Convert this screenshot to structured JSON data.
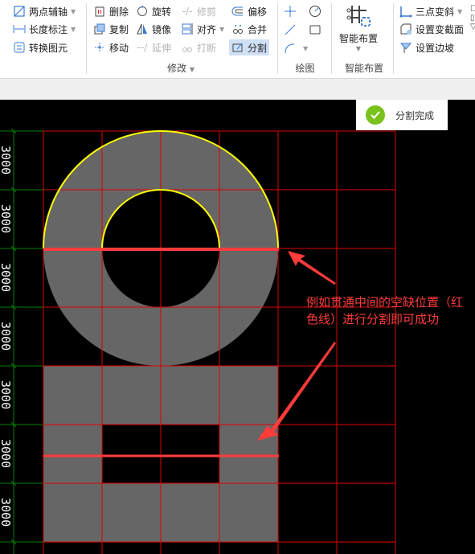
{
  "ribbon": {
    "col1": [
      {
        "label": "两点辅轴",
        "icon": "two-point-axis-icon",
        "dropdown": true
      },
      {
        "label": "长度标注",
        "icon": "length-dimension-icon",
        "dropdown": true
      },
      {
        "label": "转换图元",
        "icon": "convert-element-icon",
        "dropdown": false
      }
    ],
    "modify": {
      "group_label": "修改",
      "buttons": [
        {
          "label": "删除",
          "icon": "delete-icon",
          "enabled": true
        },
        {
          "label": "旋转",
          "icon": "rotate-icon",
          "enabled": true
        },
        {
          "label": "修剪",
          "icon": "trim-icon",
          "enabled": false
        },
        {
          "label": "偏移",
          "icon": "offset-icon",
          "enabled": true
        },
        {
          "label": "复制",
          "icon": "copy-icon",
          "enabled": true
        },
        {
          "label": "镜像",
          "icon": "mirror-icon",
          "enabled": true
        },
        {
          "label": "对齐",
          "icon": "align-icon",
          "enabled": true,
          "dropdown": true
        },
        {
          "label": "合并",
          "icon": "merge-icon",
          "enabled": true
        },
        {
          "label": "移动",
          "icon": "move-icon",
          "enabled": true
        },
        {
          "label": "延伸",
          "icon": "extend-icon",
          "enabled": false
        },
        {
          "label": "打断",
          "icon": "break-icon",
          "enabled": false
        },
        {
          "label": "分割",
          "icon": "split-icon",
          "enabled": true,
          "active": true
        }
      ]
    },
    "draw": {
      "group_label": "绘图"
    },
    "smart": {
      "button_label": "智能布置",
      "group_label": "智能布置"
    },
    "col_right": [
      {
        "label": "三点变斜",
        "icon": "three-point-slope-icon",
        "dropdown": true
      },
      {
        "label": "设置变截面",
        "icon": "variable-section-icon",
        "dropdown": false
      },
      {
        "label": "设置边坡",
        "icon": "set-slope-icon",
        "dropdown": false
      }
    ]
  },
  "toast": {
    "message": "分割完成",
    "color": "#7ac21b"
  },
  "canvas": {
    "dimension_labels": [
      "3000",
      "3000",
      "3000",
      "3000",
      "3000",
      "3000",
      "3000"
    ],
    "annotation": "例如贯通中间的空缺位置（红色线）进行分割即可成功",
    "colors": {
      "grid": "#e00000",
      "dimension": "#008000",
      "fill": "#666666",
      "outline": "#ffff00",
      "split_line": "#ff3b3b"
    }
  }
}
